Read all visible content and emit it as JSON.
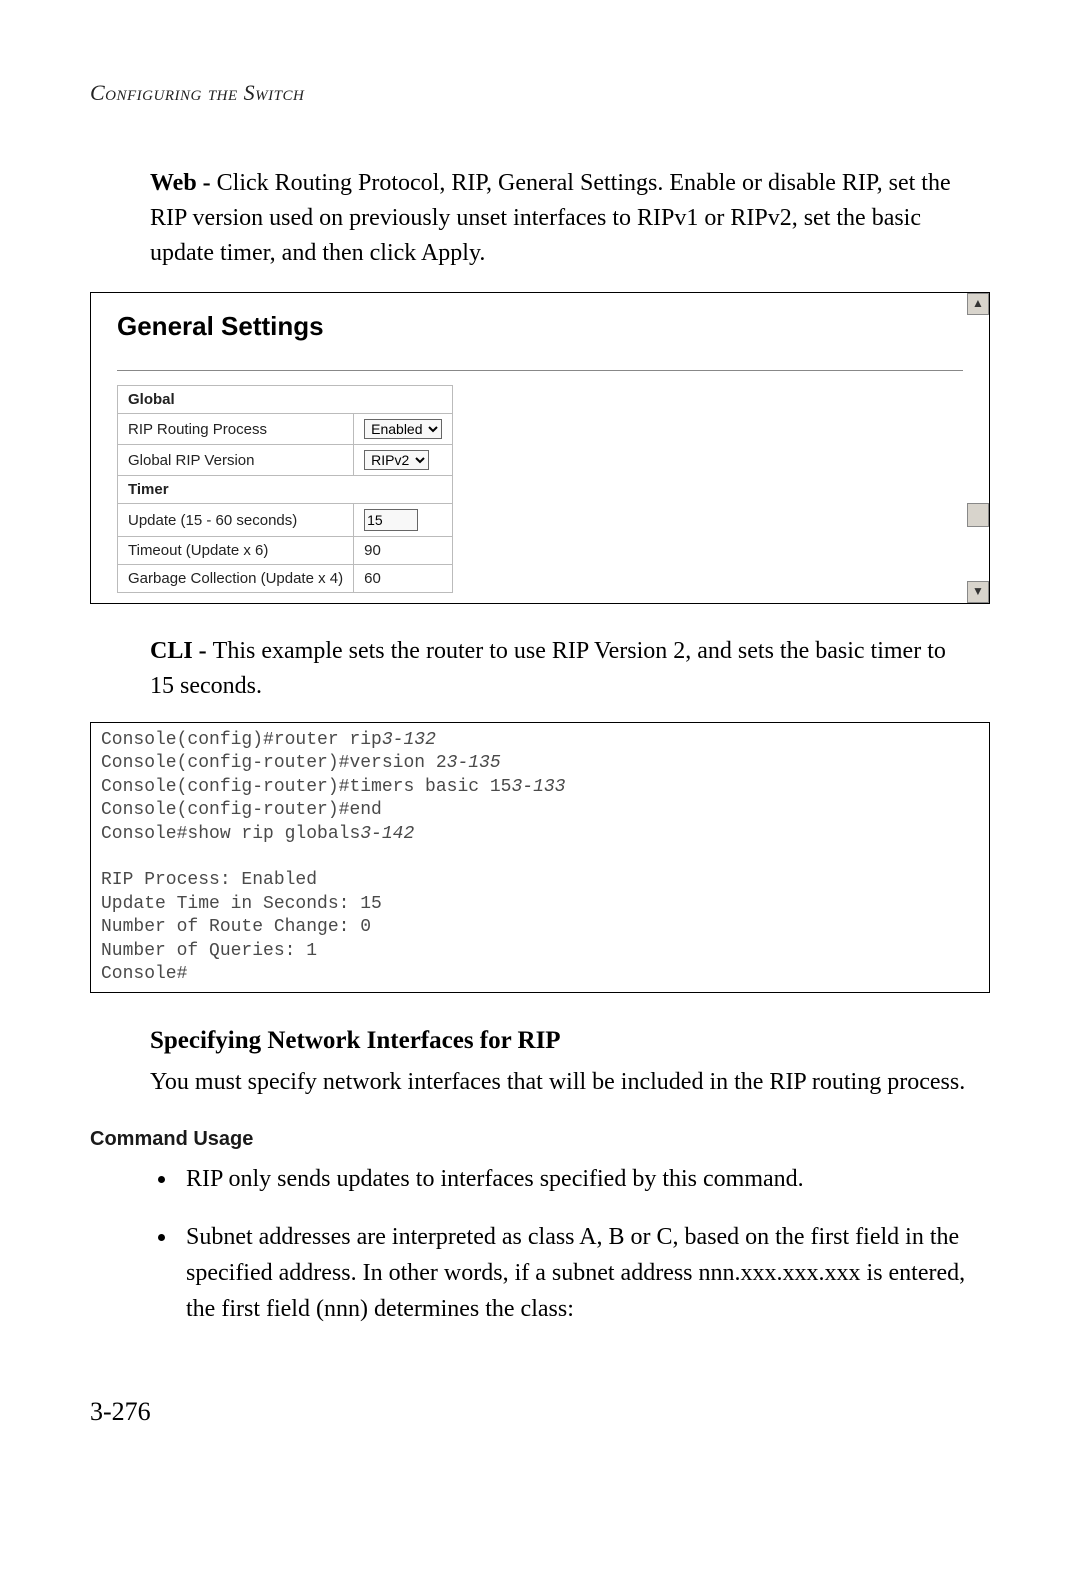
{
  "running_head": "Configuring the Switch",
  "web_para": {
    "lead": "Web - ",
    "text": "Click Routing Protocol, RIP, General Settings. Enable or disable RIP, set the RIP version used on previously unset interfaces to RIPv1 or RIPv2, set the basic update timer, and then click Apply."
  },
  "gui": {
    "title": "General Settings",
    "sections": {
      "global_header": "Global",
      "rip_routing_process_label": "RIP Routing Process",
      "rip_routing_process_value": "Enabled",
      "global_rip_version_label": "Global RIP Version",
      "global_rip_version_value": "RIPv2",
      "timer_header": "Timer",
      "update_label": "Update (15 - 60 seconds)",
      "update_value": "15",
      "timeout_label": "Timeout (Update x 6)",
      "timeout_value": "90",
      "gc_label": "Garbage Collection (Update x 4)",
      "gc_value": "60"
    }
  },
  "cli_para": {
    "lead": "CLI - ",
    "text": "This example sets the router to use RIP Version 2, and sets the basic timer to 15 seconds."
  },
  "cli": {
    "l1a": "Console(config)#router rip",
    "l1b": "3-132",
    "l2a": "Console(config-router)#version 2",
    "l2b": "3-135",
    "l3a": "Console(config-router)#timers basic 15",
    "l3b": "3-133",
    "l4": "Console(config-router)#end",
    "l5a": "Console#show rip globals",
    "l5b": "3-142",
    "blank": "",
    "l6": "RIP Process: Enabled",
    "l7": "Update Time in Seconds: 15",
    "l8": "Number of Route Change: 0",
    "l9": "Number of Queries: 1",
    "l10": "Console#"
  },
  "subsection_title": "Specifying Network Interfaces for RIP",
  "subsection_para": "You must specify network interfaces that will be included in the RIP routing process.",
  "cmd_usage_heading": "Command Usage",
  "bullets": {
    "b1": "RIP only sends updates to interfaces specified by this command.",
    "b2": "Subnet addresses are interpreted as class A, B or C, based on the first field in the specified address. In other words, if a subnet address nnn.xxx.xxx.xxx is entered, the first field (nnn) determines the class:"
  },
  "page_number": "3-276"
}
